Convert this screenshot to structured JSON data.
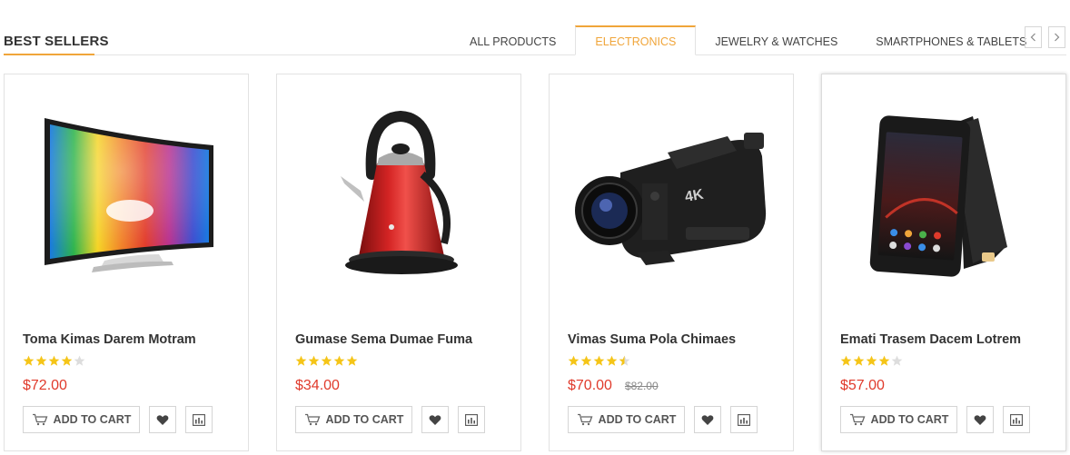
{
  "section": {
    "title": "BEST SELLERS"
  },
  "tabs": [
    {
      "label": "ALL PRODUCTS",
      "active": false
    },
    {
      "label": "ELECTRONICS",
      "active": true
    },
    {
      "label": "JEWELRY & WATCHES",
      "active": false
    },
    {
      "label": "SMARTPHONES & TABLETS",
      "active": false
    }
  ],
  "colors": {
    "accent": "#f0a53a",
    "price": "#e03a2b",
    "star": "#f5c518",
    "star_empty": "#dddddd"
  },
  "icons": {
    "prev": "chevron-left-icon",
    "next": "chevron-right-icon",
    "cart": "cart-icon",
    "wishlist": "heart-icon",
    "compare": "bar-chart-icon"
  },
  "products": [
    {
      "name": "Toma Kimas Darem Motram",
      "rating": 4,
      "price": "$72.00",
      "old_price": "",
      "add_to_cart": "ADD TO CART",
      "image": "curved-tv"
    },
    {
      "name": "Gumase Sema Dumae Fuma",
      "rating": 5,
      "price": "$34.00",
      "old_price": "",
      "add_to_cart": "ADD TO CART",
      "image": "red-kettle"
    },
    {
      "name": "Vimas Suma Pola Chimaes",
      "rating": 4.5,
      "price": "$70.00",
      "old_price": "$82.00",
      "add_to_cart": "ADD TO CART",
      "image": "4k-camcorder"
    },
    {
      "name": "Emati Trasem Dacem Lotrem",
      "rating": 4,
      "price": "$57.00",
      "old_price": "",
      "add_to_cart": "ADD TO CART",
      "image": "smartphone"
    }
  ]
}
